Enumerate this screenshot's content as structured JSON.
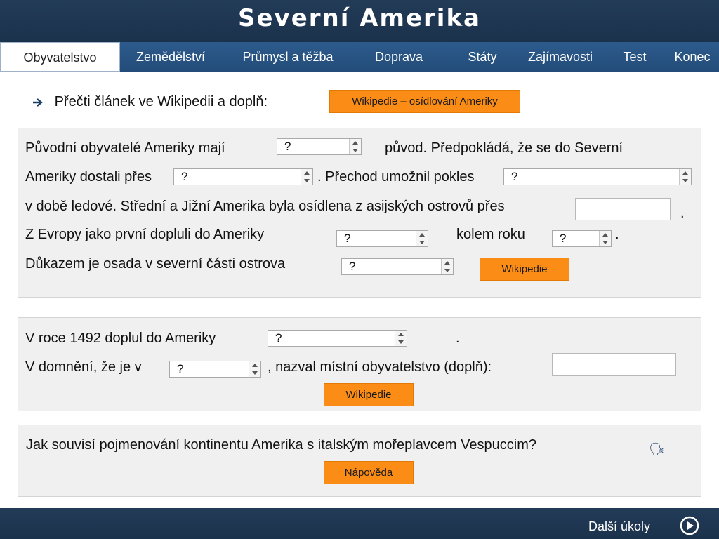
{
  "header": {
    "title": "Severní Amerika"
  },
  "nav": {
    "items": [
      {
        "label": "Obyvatelstvo"
      },
      {
        "label": "Zemědělství"
      },
      {
        "label": "Průmysl a těžba"
      },
      {
        "label": "Doprava"
      },
      {
        "label": "Státy"
      },
      {
        "label": "Zajímavosti"
      },
      {
        "label": "Test"
      },
      {
        "label": "Konec"
      }
    ]
  },
  "instruction": {
    "text": "Přečti článek ve Wikipedii a doplň:",
    "link_label": "Wikipedie – osídlování Ameriky"
  },
  "section1": {
    "t1": "Původní obyvatelé Ameriky mají",
    "t2": "původ. Předpokládá, že se do Severní",
    "t3": "Ameriky dostali přes",
    "t4": ". Přechod umožnil pokles",
    "t5": "v době ledové. Střední a Jižní Amerika byla osídlena z asijských ostrovů přes",
    "t6": ".",
    "t7": "Z Evropy jako první dopluli do Ameriky",
    "t8": "kolem roku",
    "t9": ".",
    "t10": "Důkazem je osada v severní části ostrova",
    "s1": "?",
    "s2": "?",
    "s3": "?",
    "s4": "?",
    "s5": "?",
    "s6": "?",
    "button": "Wikipedie"
  },
  "section2": {
    "t1": "V roce 1492 doplul do Ameriky",
    "t2": ".",
    "t3": "V domnění, že je v",
    "t4": ", nazval místní obyvatelstvo (doplň):",
    "s1": "?",
    "s2": "?",
    "button": "Wikipedie"
  },
  "section3": {
    "question": "Jak souvisí pojmenování kontinentu Amerika s italským mořeplavcem Vespuccim?",
    "button": "Nápověda",
    "speaker_icon": "🗣"
  },
  "footer": {
    "next_label": "Další úkoly"
  },
  "colors": {
    "navy": "#1b324c",
    "nav_blue": "#2c5b8c",
    "orange": "#fb8c16",
    "panel": "#f0f0f0"
  }
}
